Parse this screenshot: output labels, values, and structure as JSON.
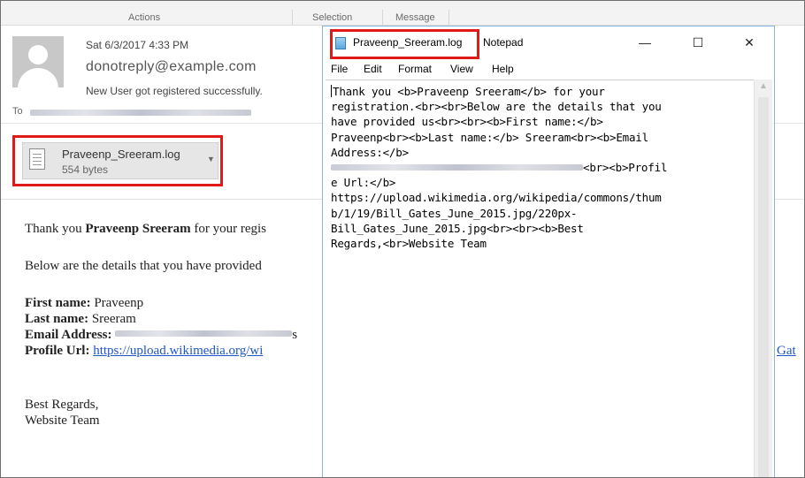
{
  "ribbon": {
    "actions": "Actions",
    "selection": "Selection",
    "message": "Message"
  },
  "email": {
    "date": "Sat 6/3/2017 4:33 PM",
    "sender": "donotreply@example.com",
    "subject": "New User got registered successfully.",
    "to_label": "To",
    "attachment": {
      "name": "Praveenp_Sreeram.log",
      "size": "554 bytes"
    },
    "body": {
      "thanks_prefix": "Thank you ",
      "thanks_name": "Praveenp Sreeram",
      "thanks_suffix": " for your regis",
      "details": "Below are the details that you have provided",
      "first_label": "First name:",
      "first_value": " Praveenp",
      "last_label": "Last name:",
      "last_value": " Sreeram",
      "email_label": "Email Address:",
      "email_tail": "s",
      "profile_label": "Profile Url:",
      "profile_link": "https://upload.wikimedia.org/wi",
      "profile_link_tail": "Gat",
      "regards": "Best Regards,",
      "team": "Website Team"
    }
  },
  "notepad": {
    "filename": "Praveenp_Sreeram.log",
    "app": "Notepad",
    "controls": {
      "minimize": "—",
      "maximize": "☐",
      "close": "✕"
    },
    "menu": [
      "File",
      "Edit",
      "Format",
      "View",
      "Help"
    ],
    "lines": [
      "Thank you <b>Praveenp Sreeram</b> for your",
      "registration.<br><br>Below are the details that you",
      "have provided us<br><br><b>First name:</b>",
      "Praveenp<br><b>Last name:</b> Sreeram<br><b>Email",
      "Address:</b>",
      "<br><b>Profil",
      "e Url:</b>",
      "https://upload.wikimedia.org/wikipedia/commons/thum",
      "b/1/19/Bill_Gates_June_2015.jpg/220px-",
      "Bill_Gates_June_2015.jpg<br><br><b>Best",
      "Regards,<br>Website Team"
    ]
  },
  "colors": {
    "highlight": "#e01919",
    "link": "#1f56c8"
  },
  "icons": [
    "contact-avatar-icon",
    "file-icon",
    "chevron-down-icon",
    "notepad-icon",
    "scroll-up-icon"
  ]
}
